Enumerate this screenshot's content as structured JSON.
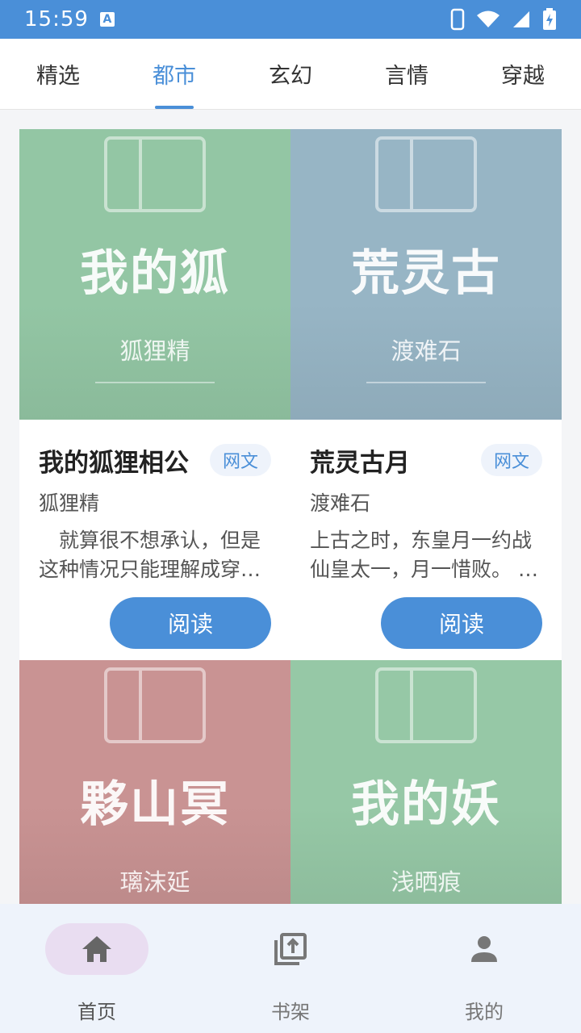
{
  "status": {
    "time": "15:59",
    "notif": "A"
  },
  "tabs": [
    {
      "label": "精选"
    },
    {
      "label": "都市",
      "active": true
    },
    {
      "label": "玄幻"
    },
    {
      "label": "言情"
    },
    {
      "label": "穿越"
    }
  ],
  "books": [
    {
      "cover_title": "我的狐",
      "cover_author": "狐狸精",
      "title": "我的狐狸相公",
      "tag": "网文",
      "author": "狐狸精",
      "desc": "　就算很不想承认，但是这种情况只能理解成穿…",
      "read": "阅读",
      "color": "#93c6a4"
    },
    {
      "cover_title": "荒灵古",
      "cover_author": "渡难石",
      "title": "荒灵古月",
      "tag": "网文",
      "author": "渡难石",
      "desc": "上古之时，东皇月一约战仙皇太一，月一惜败。 …",
      "read": "阅读",
      "color": "#97b5c5"
    },
    {
      "cover_title": "夥山冥",
      "cover_author": "璃沫延",
      "color": "#c99393"
    },
    {
      "cover_title": "我的妖",
      "cover_author": "浅晒痕",
      "color": "#96c8a6"
    }
  ],
  "nav": [
    {
      "label": "首页",
      "icon": "home-icon",
      "active": true
    },
    {
      "label": "书架",
      "icon": "bookshelf-icon"
    },
    {
      "label": "我的",
      "icon": "profile-icon"
    }
  ],
  "colors": {
    "accent": "#4a8fd8",
    "nav_bg": "#eef3fb",
    "nav_active_pill": "#e9ddf1"
  }
}
